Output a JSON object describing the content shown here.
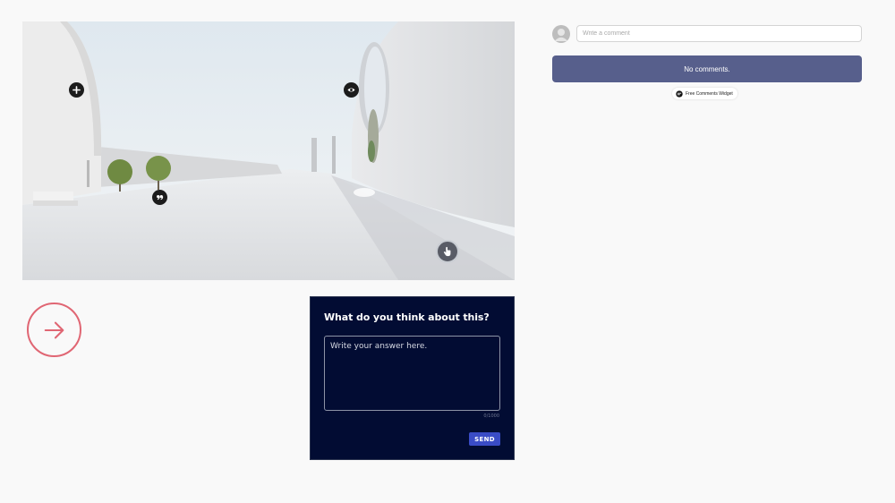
{
  "scene": {
    "hotspots": [
      {
        "name": "hotspot-add",
        "icon": "plus-icon"
      },
      {
        "name": "hotspot-view",
        "icon": "eye-icon"
      },
      {
        "name": "hotspot-quote",
        "icon": "quote-icon"
      }
    ],
    "interaction_icon": "hand-pointer-icon"
  },
  "navigation": {
    "next_icon": "arrow-right-icon",
    "accent_color": "#e06673"
  },
  "question": {
    "title": "What do you think about this?",
    "placeholder": "Write your answer here.",
    "char_count": "0/1000",
    "send_label": "SEND",
    "background_color": "#020c33",
    "button_color": "#3a4cc6"
  },
  "comments": {
    "input_placeholder": "Write a comment",
    "empty_label": "No comments.",
    "widget_label": "Free Comments Widget",
    "banner_color": "#575f8c"
  }
}
